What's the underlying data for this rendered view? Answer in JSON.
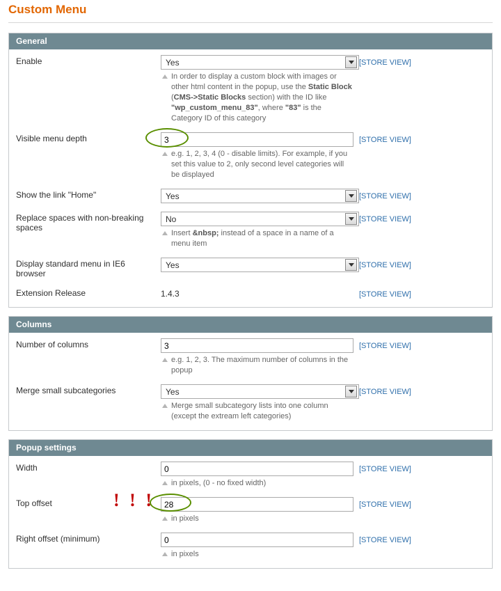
{
  "pageTitle": "Custom Menu",
  "scopeLabel": "[STORE VIEW]",
  "sections": {
    "general": {
      "title": "General",
      "enable": {
        "label": "Enable",
        "value": "Yes",
        "hint": [
          "In order to display a custom block with images or other html content in the popup, use the ",
          "Static Block",
          " (",
          "CMS->Static Blocks",
          " section) with the ID like ",
          "\"wp_custom_menu_83\"",
          ", where ",
          "\"83\"",
          " is the Category ID of this category"
        ]
      },
      "depth": {
        "label": "Visible menu depth",
        "value": "3",
        "hint": "e.g. 1, 2, 3, 4 (0 - disable limits). For example, if you set this value to 2, only second level categories will be displayed"
      },
      "home": {
        "label": "Show the link \"Home\"",
        "value": "Yes"
      },
      "nbsp": {
        "label": "Replace spaces with non-breaking spaces",
        "value": "No",
        "hint": [
          "Insert ",
          "&nbsp;",
          " instead of a space in a name of a menu item"
        ]
      },
      "ie6": {
        "label": "Display standard menu in IE6 browser",
        "value": "Yes"
      },
      "release": {
        "label": "Extension Release",
        "value": "1.4.3"
      }
    },
    "columns": {
      "title": "Columns",
      "count": {
        "label": "Number of columns",
        "value": "3",
        "hint": "e.g. 1, 2, 3. The maximum number of columns in the popup"
      },
      "merge": {
        "label": "Merge small subcategories",
        "value": "Yes",
        "hint": "Merge small subcategory lists into one column (except the extream left categories)"
      }
    },
    "popup": {
      "title": "Popup settings",
      "width": {
        "label": "Width",
        "value": "0",
        "hint": "in pixels, (0 - no fixed width)"
      },
      "top": {
        "label": "Top offset",
        "value": "28",
        "hint": "in pixels"
      },
      "right": {
        "label": "Right offset (minimum)",
        "value": "0",
        "hint": "in pixels"
      }
    }
  },
  "annotations": {
    "bang": "! ! !"
  }
}
